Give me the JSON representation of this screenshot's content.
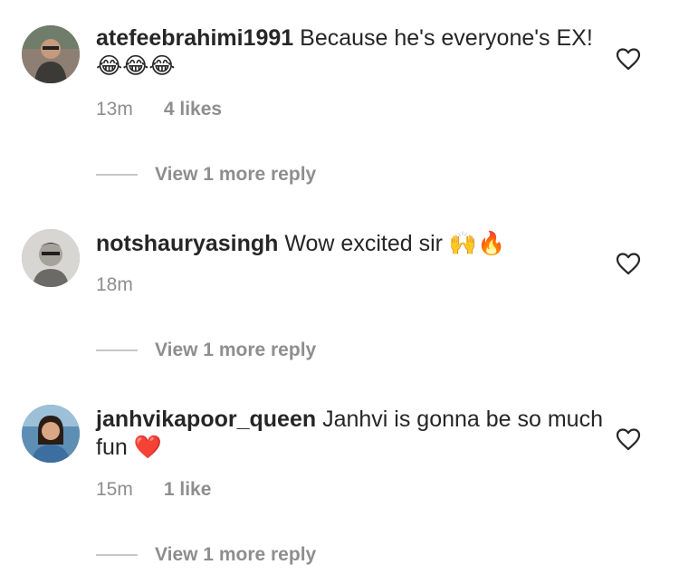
{
  "comments": [
    {
      "username": "atefeebrahimi1991",
      "text": "Because he's everyone's EX!",
      "emojis": "😂😂😂",
      "time": "13m",
      "likes": "4 likes",
      "reply_label": "View 1 more reply",
      "avatar_icon": "avatar-photo"
    },
    {
      "username": "notshauryasingh",
      "text": "Wow excited sir",
      "emojis": "🙌🔥",
      "time": "18m",
      "likes": "",
      "reply_label": "View 1 more reply",
      "avatar_icon": "avatar-photo"
    },
    {
      "username": "janhvikapoor_queen",
      "text": "Janhvi is gonna be so much fun",
      "emojis": "❤️",
      "time": "15m",
      "likes": "1 like",
      "reply_label": "View 1 more reply",
      "avatar_icon": "avatar-photo"
    }
  ],
  "icons": {
    "like": "heart-outline-icon"
  },
  "colors": {
    "text": "#262626",
    "secondary": "#8e8e8e",
    "divider": "#c7c7c7"
  }
}
